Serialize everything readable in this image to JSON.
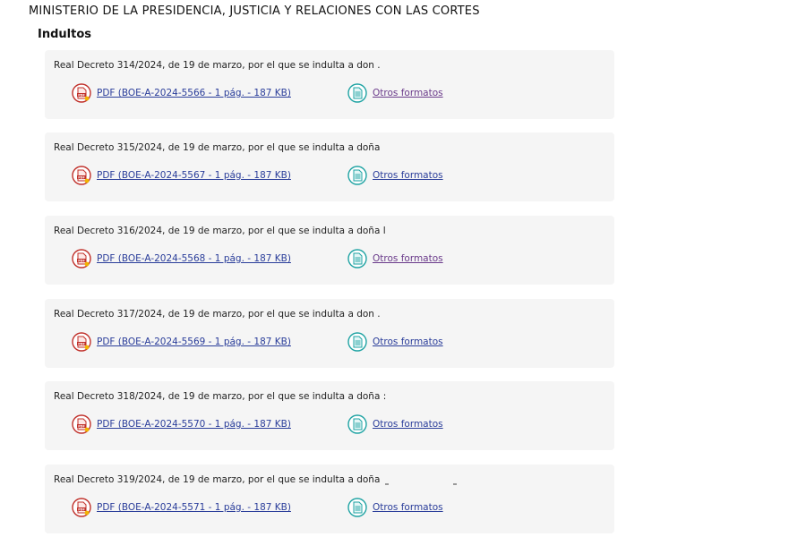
{
  "ministry": "MINISTERIO DE LA PRESIDENCIA, JUSTICIA Y RELACIONES CON LAS CORTES",
  "section": "Indultos",
  "items": [
    {
      "title": "Real Decreto 314/2024, de 19 de marzo, por el que se indulta a don .",
      "pdf_label": "PDF (BOE-A-2024-5566 - 1 pág. - 187 KB)",
      "other_label": "Otros formatos"
    },
    {
      "title": "Real Decreto 315/2024, de 19 de marzo, por el que se indulta a doña",
      "pdf_label": "PDF (BOE-A-2024-5567 - 1 pág. - 187 KB)",
      "other_label": "Otros formatos"
    },
    {
      "title": "Real Decreto 316/2024, de 19 de marzo, por el que se indulta a doña l",
      "pdf_label": "PDF (BOE-A-2024-5568 - 1 pág. - 187 KB)",
      "other_label": "Otros formatos"
    },
    {
      "title": "Real Decreto 317/2024, de 19 de marzo, por el que se indulta a don .",
      "pdf_label": "PDF (BOE-A-2024-5569 - 1 pág. - 187 KB)",
      "other_label": "Otros formatos"
    },
    {
      "title": "Real Decreto 318/2024, de 19 de marzo, por el que se indulta a doña :",
      "pdf_label": "PDF (BOE-A-2024-5570 - 1 pág. - 187 KB)",
      "other_label": "Otros formatos"
    },
    {
      "title": "Real Decreto 319/2024, de 19 de marzo, por el que se indulta a doña",
      "pdf_label": "PDF (BOE-A-2024-5571 - 1 pág. - 187 KB)",
      "other_label": "Otros formatos"
    }
  ],
  "icons": {
    "pdf": "pdf-file-icon",
    "other": "document-formats-icon"
  },
  "colors": {
    "link": "#2a3d9a",
    "visited_link": "#6a3a8a",
    "pdf_icon": "#c0302a",
    "other_icon": "#1fa3a3",
    "item_background": "#f5f5f5"
  }
}
